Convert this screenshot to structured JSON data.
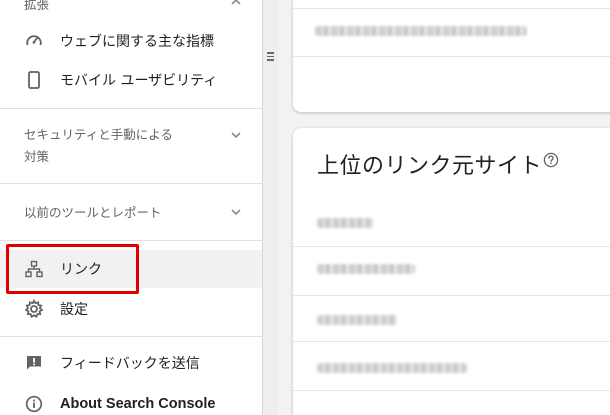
{
  "sidebar": {
    "top_section_label": "拡張",
    "items_top": [
      {
        "label": "ウェブに関する主な指標",
        "icon": "speedometer-icon"
      },
      {
        "label": "モバイル ユーザビリティ",
        "icon": "smartphone-icon"
      }
    ],
    "security_section_label_line1": "セキュリティと手動による",
    "security_section_label_line2": "対策",
    "legacy_section_label": "以前のツールとレポート",
    "items_bottom": [
      {
        "label": "リンク",
        "icon": "sitemap-icon",
        "selected": true
      },
      {
        "label": "設定",
        "icon": "gear-icon"
      },
      {
        "label": "フィードバックを送信",
        "icon": "feedback-icon"
      },
      {
        "label": "About Search Console",
        "icon": "info-icon"
      }
    ]
  },
  "main": {
    "links_card": {
      "title": "上位のリンク元サイト",
      "help_icon": "help-circle-icon"
    }
  },
  "colors": {
    "highlight": "#e00000",
    "text_primary": "#202124",
    "text_secondary": "#5f6368",
    "selected_bg": "#f1f1f1",
    "page_bg": "#f1f3f4"
  }
}
